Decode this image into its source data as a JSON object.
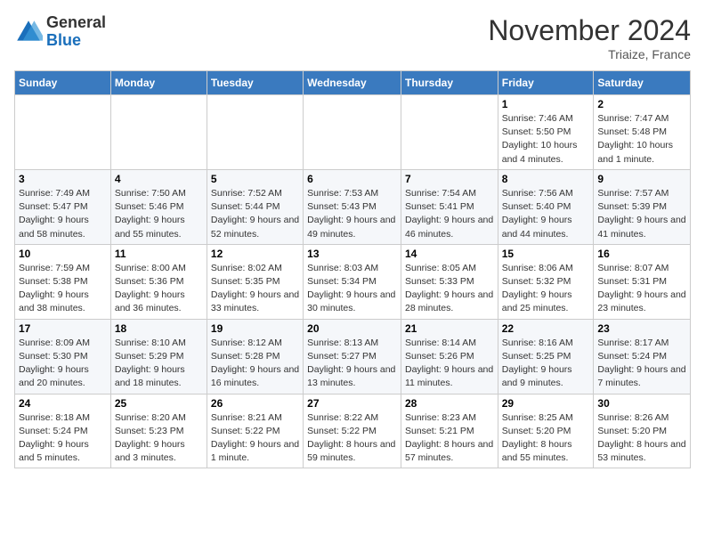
{
  "header": {
    "logo": {
      "general": "General",
      "blue": "Blue"
    },
    "title": "November 2024",
    "subtitle": "Triaize, France"
  },
  "columns": [
    "Sunday",
    "Monday",
    "Tuesday",
    "Wednesday",
    "Thursday",
    "Friday",
    "Saturday"
  ],
  "weeks": [
    [
      {
        "day": "",
        "info": ""
      },
      {
        "day": "",
        "info": ""
      },
      {
        "day": "",
        "info": ""
      },
      {
        "day": "",
        "info": ""
      },
      {
        "day": "",
        "info": ""
      },
      {
        "day": "1",
        "info": "Sunrise: 7:46 AM\nSunset: 5:50 PM\nDaylight: 10 hours and 4 minutes."
      },
      {
        "day": "2",
        "info": "Sunrise: 7:47 AM\nSunset: 5:48 PM\nDaylight: 10 hours and 1 minute."
      }
    ],
    [
      {
        "day": "3",
        "info": "Sunrise: 7:49 AM\nSunset: 5:47 PM\nDaylight: 9 hours and 58 minutes."
      },
      {
        "day": "4",
        "info": "Sunrise: 7:50 AM\nSunset: 5:46 PM\nDaylight: 9 hours and 55 minutes."
      },
      {
        "day": "5",
        "info": "Sunrise: 7:52 AM\nSunset: 5:44 PM\nDaylight: 9 hours and 52 minutes."
      },
      {
        "day": "6",
        "info": "Sunrise: 7:53 AM\nSunset: 5:43 PM\nDaylight: 9 hours and 49 minutes."
      },
      {
        "day": "7",
        "info": "Sunrise: 7:54 AM\nSunset: 5:41 PM\nDaylight: 9 hours and 46 minutes."
      },
      {
        "day": "8",
        "info": "Sunrise: 7:56 AM\nSunset: 5:40 PM\nDaylight: 9 hours and 44 minutes."
      },
      {
        "day": "9",
        "info": "Sunrise: 7:57 AM\nSunset: 5:39 PM\nDaylight: 9 hours and 41 minutes."
      }
    ],
    [
      {
        "day": "10",
        "info": "Sunrise: 7:59 AM\nSunset: 5:38 PM\nDaylight: 9 hours and 38 minutes."
      },
      {
        "day": "11",
        "info": "Sunrise: 8:00 AM\nSunset: 5:36 PM\nDaylight: 9 hours and 36 minutes."
      },
      {
        "day": "12",
        "info": "Sunrise: 8:02 AM\nSunset: 5:35 PM\nDaylight: 9 hours and 33 minutes."
      },
      {
        "day": "13",
        "info": "Sunrise: 8:03 AM\nSunset: 5:34 PM\nDaylight: 9 hours and 30 minutes."
      },
      {
        "day": "14",
        "info": "Sunrise: 8:05 AM\nSunset: 5:33 PM\nDaylight: 9 hours and 28 minutes."
      },
      {
        "day": "15",
        "info": "Sunrise: 8:06 AM\nSunset: 5:32 PM\nDaylight: 9 hours and 25 minutes."
      },
      {
        "day": "16",
        "info": "Sunrise: 8:07 AM\nSunset: 5:31 PM\nDaylight: 9 hours and 23 minutes."
      }
    ],
    [
      {
        "day": "17",
        "info": "Sunrise: 8:09 AM\nSunset: 5:30 PM\nDaylight: 9 hours and 20 minutes."
      },
      {
        "day": "18",
        "info": "Sunrise: 8:10 AM\nSunset: 5:29 PM\nDaylight: 9 hours and 18 minutes."
      },
      {
        "day": "19",
        "info": "Sunrise: 8:12 AM\nSunset: 5:28 PM\nDaylight: 9 hours and 16 minutes."
      },
      {
        "day": "20",
        "info": "Sunrise: 8:13 AM\nSunset: 5:27 PM\nDaylight: 9 hours and 13 minutes."
      },
      {
        "day": "21",
        "info": "Sunrise: 8:14 AM\nSunset: 5:26 PM\nDaylight: 9 hours and 11 minutes."
      },
      {
        "day": "22",
        "info": "Sunrise: 8:16 AM\nSunset: 5:25 PM\nDaylight: 9 hours and 9 minutes."
      },
      {
        "day": "23",
        "info": "Sunrise: 8:17 AM\nSunset: 5:24 PM\nDaylight: 9 hours and 7 minutes."
      }
    ],
    [
      {
        "day": "24",
        "info": "Sunrise: 8:18 AM\nSunset: 5:24 PM\nDaylight: 9 hours and 5 minutes."
      },
      {
        "day": "25",
        "info": "Sunrise: 8:20 AM\nSunset: 5:23 PM\nDaylight: 9 hours and 3 minutes."
      },
      {
        "day": "26",
        "info": "Sunrise: 8:21 AM\nSunset: 5:22 PM\nDaylight: 9 hours and 1 minute."
      },
      {
        "day": "27",
        "info": "Sunrise: 8:22 AM\nSunset: 5:22 PM\nDaylight: 8 hours and 59 minutes."
      },
      {
        "day": "28",
        "info": "Sunrise: 8:23 AM\nSunset: 5:21 PM\nDaylight: 8 hours and 57 minutes."
      },
      {
        "day": "29",
        "info": "Sunrise: 8:25 AM\nSunset: 5:20 PM\nDaylight: 8 hours and 55 minutes."
      },
      {
        "day": "30",
        "info": "Sunrise: 8:26 AM\nSunset: 5:20 PM\nDaylight: 8 hours and 53 minutes."
      }
    ]
  ]
}
